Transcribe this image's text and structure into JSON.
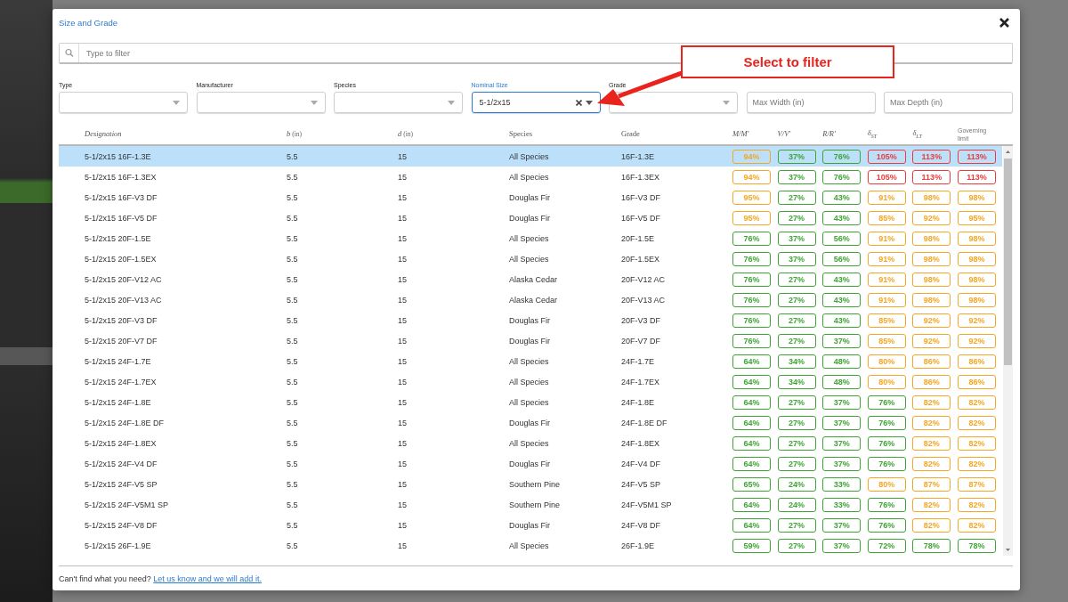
{
  "dialog": {
    "title": "Size and Grade"
  },
  "search": {
    "placeholder": "Type to filter"
  },
  "filters": [
    {
      "kind": "select",
      "label": "Type",
      "focused": false
    },
    {
      "kind": "select",
      "label": "Manufacturer",
      "focused": false
    },
    {
      "kind": "select",
      "label": "Species",
      "focused": false
    },
    {
      "kind": "select",
      "label": "Nominal Size",
      "value": "5-1/2x15",
      "focused": true
    },
    {
      "kind": "select",
      "label": "Grade",
      "focused": false
    },
    {
      "kind": "input",
      "placeholder": "Max Width (in)",
      "focused": false
    },
    {
      "kind": "input",
      "placeholder": "Max Depth (in)",
      "focused": false
    }
  ],
  "annotation": {
    "text": "Select to filter"
  },
  "table": {
    "columns": [
      {
        "kind": "math",
        "label": "Designation"
      },
      {
        "kind": "math",
        "label": "b",
        "unit": "(in)"
      },
      {
        "kind": "math",
        "label": "d",
        "unit": "(in)"
      },
      {
        "kind": "text",
        "label": "Species"
      },
      {
        "kind": "text",
        "label": "Grade"
      },
      {
        "kind": "math",
        "label": "M/M′"
      },
      {
        "kind": "math",
        "label": "V/V′"
      },
      {
        "kind": "math",
        "label": "R/R′"
      },
      {
        "kind": "math",
        "label": "δ$_{ST}$"
      },
      {
        "kind": "math",
        "label": "δ$_{LT}$"
      },
      {
        "kind": "note",
        "label": "Governing limit"
      }
    ],
    "rows": [
      {
        "designation": "5-1/2x15 16F-1.3E",
        "b": "5.5",
        "d": "15",
        "species": "All Species",
        "grade": "16F-1.3E",
        "selected": true,
        "ratios": [
          {
            "value": "94%",
            "color": "#f5a623"
          },
          {
            "value": "37%",
            "color": "#3ea534"
          },
          {
            "value": "76%",
            "color": "#3ea534"
          },
          {
            "value": "105%",
            "color": "#ee3a3a"
          },
          {
            "value": "113%",
            "color": "#ee3a3a"
          },
          {
            "value": "113%",
            "color": "#ee3a3a"
          }
        ]
      },
      {
        "designation": "5-1/2x15 16F-1.3EX",
        "b": "5.5",
        "d": "15",
        "species": "All Species",
        "grade": "16F-1.3EX",
        "selected": false,
        "ratios": [
          {
            "value": "94%",
            "color": "#f5a623"
          },
          {
            "value": "37%",
            "color": "#3ea534"
          },
          {
            "value": "76%",
            "color": "#3ea534"
          },
          {
            "value": "105%",
            "color": "#ee3a3a"
          },
          {
            "value": "113%",
            "color": "#ee3a3a"
          },
          {
            "value": "113%",
            "color": "#ee3a3a"
          }
        ]
      },
      {
        "designation": "5-1/2x15 16F-V3 DF",
        "b": "5.5",
        "d": "15",
        "species": "Douglas Fir",
        "grade": "16F-V3 DF",
        "selected": false,
        "ratios": [
          {
            "value": "95%",
            "color": "#f5a623"
          },
          {
            "value": "27%",
            "color": "#3ea534"
          },
          {
            "value": "43%",
            "color": "#3ea534"
          },
          {
            "value": "91%",
            "color": "#f5a623"
          },
          {
            "value": "98%",
            "color": "#f5a623"
          },
          {
            "value": "98%",
            "color": "#f5a623"
          }
        ]
      },
      {
        "designation": "5-1/2x15 16F-V5 DF",
        "b": "5.5",
        "d": "15",
        "species": "Douglas Fir",
        "grade": "16F-V5 DF",
        "selected": false,
        "ratios": [
          {
            "value": "95%",
            "color": "#f5a623"
          },
          {
            "value": "27%",
            "color": "#3ea534"
          },
          {
            "value": "43%",
            "color": "#3ea534"
          },
          {
            "value": "85%",
            "color": "#f5a623"
          },
          {
            "value": "92%",
            "color": "#f5a623"
          },
          {
            "value": "95%",
            "color": "#f5a623"
          }
        ]
      },
      {
        "designation": "5-1/2x15 20F-1.5E",
        "b": "5.5",
        "d": "15",
        "species": "All Species",
        "grade": "20F-1.5E",
        "selected": false,
        "ratios": [
          {
            "value": "76%",
            "color": "#3ea534"
          },
          {
            "value": "37%",
            "color": "#3ea534"
          },
          {
            "value": "56%",
            "color": "#3ea534"
          },
          {
            "value": "91%",
            "color": "#f5a623"
          },
          {
            "value": "98%",
            "color": "#f5a623"
          },
          {
            "value": "98%",
            "color": "#f5a623"
          }
        ]
      },
      {
        "designation": "5-1/2x15 20F-1.5EX",
        "b": "5.5",
        "d": "15",
        "species": "All Species",
        "grade": "20F-1.5EX",
        "selected": false,
        "ratios": [
          {
            "value": "76%",
            "color": "#3ea534"
          },
          {
            "value": "37%",
            "color": "#3ea534"
          },
          {
            "value": "56%",
            "color": "#3ea534"
          },
          {
            "value": "91%",
            "color": "#f5a623"
          },
          {
            "value": "98%",
            "color": "#f5a623"
          },
          {
            "value": "98%",
            "color": "#f5a623"
          }
        ]
      },
      {
        "designation": "5-1/2x15 20F-V12 AC",
        "b": "5.5",
        "d": "15",
        "species": "Alaska Cedar",
        "grade": "20F-V12 AC",
        "selected": false,
        "ratios": [
          {
            "value": "76%",
            "color": "#3ea534"
          },
          {
            "value": "27%",
            "color": "#3ea534"
          },
          {
            "value": "43%",
            "color": "#3ea534"
          },
          {
            "value": "91%",
            "color": "#f5a623"
          },
          {
            "value": "98%",
            "color": "#f5a623"
          },
          {
            "value": "98%",
            "color": "#f5a623"
          }
        ]
      },
      {
        "designation": "5-1/2x15 20F-V13 AC",
        "b": "5.5",
        "d": "15",
        "species": "Alaska Cedar",
        "grade": "20F-V13 AC",
        "selected": false,
        "ratios": [
          {
            "value": "76%",
            "color": "#3ea534"
          },
          {
            "value": "27%",
            "color": "#3ea534"
          },
          {
            "value": "43%",
            "color": "#3ea534"
          },
          {
            "value": "91%",
            "color": "#f5a623"
          },
          {
            "value": "98%",
            "color": "#f5a623"
          },
          {
            "value": "98%",
            "color": "#f5a623"
          }
        ]
      },
      {
        "designation": "5-1/2x15 20F-V3 DF",
        "b": "5.5",
        "d": "15",
        "species": "Douglas Fir",
        "grade": "20F-V3 DF",
        "selected": false,
        "ratios": [
          {
            "value": "76%",
            "color": "#3ea534"
          },
          {
            "value": "27%",
            "color": "#3ea534"
          },
          {
            "value": "43%",
            "color": "#3ea534"
          },
          {
            "value": "85%",
            "color": "#f5a623"
          },
          {
            "value": "92%",
            "color": "#f5a623"
          },
          {
            "value": "92%",
            "color": "#f5a623"
          }
        ]
      },
      {
        "designation": "5-1/2x15 20F-V7 DF",
        "b": "5.5",
        "d": "15",
        "species": "Douglas Fir",
        "grade": "20F-V7 DF",
        "selected": false,
        "ratios": [
          {
            "value": "76%",
            "color": "#3ea534"
          },
          {
            "value": "27%",
            "color": "#3ea534"
          },
          {
            "value": "37%",
            "color": "#3ea534"
          },
          {
            "value": "85%",
            "color": "#f5a623"
          },
          {
            "value": "92%",
            "color": "#f5a623"
          },
          {
            "value": "92%",
            "color": "#f5a623"
          }
        ]
      },
      {
        "designation": "5-1/2x15 24F-1.7E",
        "b": "5.5",
        "d": "15",
        "species": "All Species",
        "grade": "24F-1.7E",
        "selected": false,
        "ratios": [
          {
            "value": "64%",
            "color": "#3ea534"
          },
          {
            "value": "34%",
            "color": "#3ea534"
          },
          {
            "value": "48%",
            "color": "#3ea534"
          },
          {
            "value": "80%",
            "color": "#f5a623"
          },
          {
            "value": "86%",
            "color": "#f5a623"
          },
          {
            "value": "86%",
            "color": "#f5a623"
          }
        ]
      },
      {
        "designation": "5-1/2x15 24F-1.7EX",
        "b": "5.5",
        "d": "15",
        "species": "All Species",
        "grade": "24F-1.7EX",
        "selected": false,
        "ratios": [
          {
            "value": "64%",
            "color": "#3ea534"
          },
          {
            "value": "34%",
            "color": "#3ea534"
          },
          {
            "value": "48%",
            "color": "#3ea534"
          },
          {
            "value": "80%",
            "color": "#f5a623"
          },
          {
            "value": "86%",
            "color": "#f5a623"
          },
          {
            "value": "86%",
            "color": "#f5a623"
          }
        ]
      },
      {
        "designation": "5-1/2x15 24F-1.8E",
        "b": "5.5",
        "d": "15",
        "species": "All Species",
        "grade": "24F-1.8E",
        "selected": false,
        "ratios": [
          {
            "value": "64%",
            "color": "#3ea534"
          },
          {
            "value": "27%",
            "color": "#3ea534"
          },
          {
            "value": "37%",
            "color": "#3ea534"
          },
          {
            "value": "76%",
            "color": "#3ea534"
          },
          {
            "value": "82%",
            "color": "#f5a623"
          },
          {
            "value": "82%",
            "color": "#f5a623"
          }
        ]
      },
      {
        "designation": "5-1/2x15 24F-1.8E DF",
        "b": "5.5",
        "d": "15",
        "species": "Douglas Fir",
        "grade": "24F-1.8E DF",
        "selected": false,
        "ratios": [
          {
            "value": "64%",
            "color": "#3ea534"
          },
          {
            "value": "27%",
            "color": "#3ea534"
          },
          {
            "value": "37%",
            "color": "#3ea534"
          },
          {
            "value": "76%",
            "color": "#3ea534"
          },
          {
            "value": "82%",
            "color": "#f5a623"
          },
          {
            "value": "82%",
            "color": "#f5a623"
          }
        ]
      },
      {
        "designation": "5-1/2x15 24F-1.8EX",
        "b": "5.5",
        "d": "15",
        "species": "All Species",
        "grade": "24F-1.8EX",
        "selected": false,
        "ratios": [
          {
            "value": "64%",
            "color": "#3ea534"
          },
          {
            "value": "27%",
            "color": "#3ea534"
          },
          {
            "value": "37%",
            "color": "#3ea534"
          },
          {
            "value": "76%",
            "color": "#3ea534"
          },
          {
            "value": "82%",
            "color": "#f5a623"
          },
          {
            "value": "82%",
            "color": "#f5a623"
          }
        ]
      },
      {
        "designation": "5-1/2x15 24F-V4 DF",
        "b": "5.5",
        "d": "15",
        "species": "Douglas Fir",
        "grade": "24F-V4 DF",
        "selected": false,
        "ratios": [
          {
            "value": "64%",
            "color": "#3ea534"
          },
          {
            "value": "27%",
            "color": "#3ea534"
          },
          {
            "value": "37%",
            "color": "#3ea534"
          },
          {
            "value": "76%",
            "color": "#3ea534"
          },
          {
            "value": "82%",
            "color": "#f5a623"
          },
          {
            "value": "82%",
            "color": "#f5a623"
          }
        ]
      },
      {
        "designation": "5-1/2x15 24F-V5 SP",
        "b": "5.5",
        "d": "15",
        "species": "Southern Pine",
        "grade": "24F-V5 SP",
        "selected": false,
        "ratios": [
          {
            "value": "65%",
            "color": "#3ea534"
          },
          {
            "value": "24%",
            "color": "#3ea534"
          },
          {
            "value": "33%",
            "color": "#3ea534"
          },
          {
            "value": "80%",
            "color": "#f5a623"
          },
          {
            "value": "87%",
            "color": "#f5a623"
          },
          {
            "value": "87%",
            "color": "#f5a623"
          }
        ]
      },
      {
        "designation": "5-1/2x15 24F-V5M1 SP",
        "b": "5.5",
        "d": "15",
        "species": "Southern Pine",
        "grade": "24F-V5M1 SP",
        "selected": false,
        "ratios": [
          {
            "value": "64%",
            "color": "#3ea534"
          },
          {
            "value": "24%",
            "color": "#3ea534"
          },
          {
            "value": "33%",
            "color": "#3ea534"
          },
          {
            "value": "76%",
            "color": "#3ea534"
          },
          {
            "value": "82%",
            "color": "#f5a623"
          },
          {
            "value": "82%",
            "color": "#f5a623"
          }
        ]
      },
      {
        "designation": "5-1/2x15 24F-V8 DF",
        "b": "5.5",
        "d": "15",
        "species": "Douglas Fir",
        "grade": "24F-V8 DF",
        "selected": false,
        "ratios": [
          {
            "value": "64%",
            "color": "#3ea534"
          },
          {
            "value": "27%",
            "color": "#3ea534"
          },
          {
            "value": "37%",
            "color": "#3ea534"
          },
          {
            "value": "76%",
            "color": "#3ea534"
          },
          {
            "value": "82%",
            "color": "#f5a623"
          },
          {
            "value": "82%",
            "color": "#f5a623"
          }
        ]
      },
      {
        "designation": "5-1/2x15 26F-1.9E",
        "b": "5.5",
        "d": "15",
        "species": "All Species",
        "grade": "26F-1.9E",
        "selected": false,
        "ratios": [
          {
            "value": "59%",
            "color": "#3ea534"
          },
          {
            "value": "27%",
            "color": "#3ea534"
          },
          {
            "value": "37%",
            "color": "#3ea534"
          },
          {
            "value": "72%",
            "color": "#3ea534"
          },
          {
            "value": "78%",
            "color": "#3ea534"
          },
          {
            "value": "78%",
            "color": "#3ea534"
          }
        ]
      }
    ]
  },
  "footer": {
    "text": "Can't find what you need?",
    "link": "Let us know and we will add it."
  }
}
